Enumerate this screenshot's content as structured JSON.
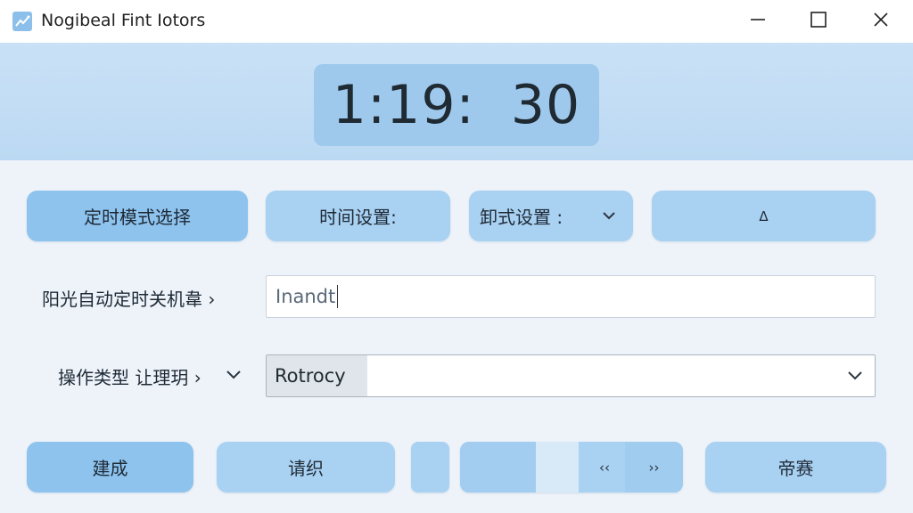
{
  "window": {
    "title": "Nogibeal Fint Iotors",
    "icon": "chart-line-icon"
  },
  "clock": {
    "display": "1:19:  30"
  },
  "toolbar": {
    "mode_label": "定时模式选择",
    "time_label": "时间设置:",
    "format_label": "卸式设置 :",
    "up_label": "Δ"
  },
  "form": {
    "shutdown_label": "阳光自动定时关机韋 ›",
    "shutdown_value": "Inandt",
    "optype_label": "操作类型 让理玥 ›",
    "optype_selected": "Rotrocy"
  },
  "bottom": {
    "build_label": "建成",
    "request_label": "请织",
    "prev_label": "‹‹",
    "next_label": "››",
    "banner_label": "帝赛"
  },
  "colors": {
    "accent": "#8ec3ee",
    "button": "#a9d1f2",
    "header": "#c9e1f6",
    "background": "#eef3f9"
  }
}
